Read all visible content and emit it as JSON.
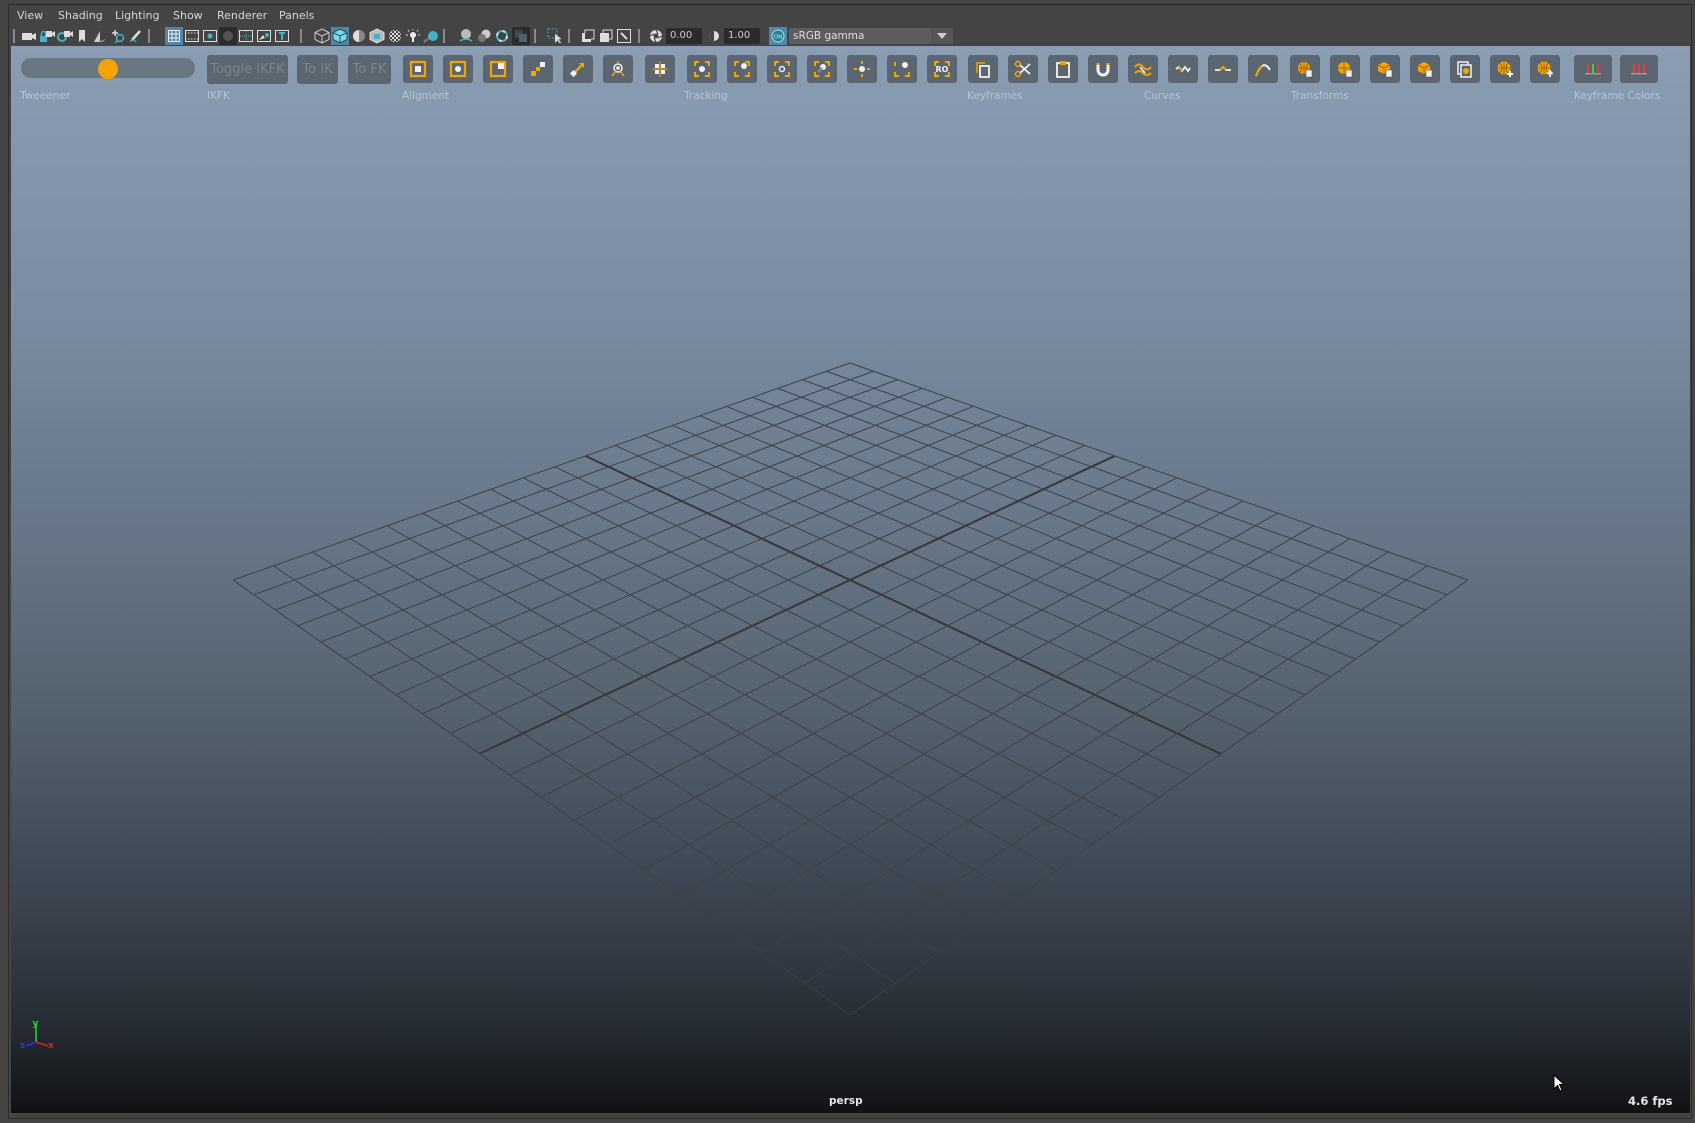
{
  "menu": {
    "items": [
      "View",
      "Shading",
      "Lighting",
      "Show",
      "Renderer",
      "Panels"
    ]
  },
  "toolbar": {
    "icons": [
      {
        "name": "select-camera-icon",
        "glyph": "camera"
      },
      {
        "name": "lock-camera-icon",
        "glyph": "camera-lock"
      },
      {
        "name": "camera-attributes-icon",
        "glyph": "camera-gear"
      },
      {
        "name": "bookmark-icon",
        "glyph": "bookmark"
      },
      {
        "name": "image-plane-icon",
        "glyph": "image-plane"
      },
      {
        "name": "2d-pan-zoom-icon",
        "glyph": "pan-zoom"
      },
      {
        "name": "grease-pencil-icon",
        "glyph": "pencil"
      },
      {
        "name": "grid-icon",
        "glyph": "grid",
        "active": true
      },
      {
        "name": "film-gate-icon",
        "glyph": "film"
      },
      {
        "name": "resolution-gate-icon",
        "glyph": "res-gate"
      },
      {
        "name": "gate-mask-icon",
        "glyph": "gate-mask",
        "pressed": true
      },
      {
        "name": "field-chart-icon",
        "glyph": "field-chart"
      },
      {
        "name": "safe-action-icon",
        "glyph": "safe-action"
      },
      {
        "name": "safe-title-icon",
        "glyph": "safe-title"
      },
      {
        "name": "wireframe-icon",
        "glyph": "wire-cube"
      },
      {
        "name": "smooth-shade-icon",
        "glyph": "solid-cube",
        "active": true
      },
      {
        "name": "default-material-icon",
        "glyph": "half-sphere"
      },
      {
        "name": "wireframe-on-shaded-icon",
        "glyph": "wire-shaded-cube"
      },
      {
        "name": "textured-icon",
        "glyph": "checker"
      },
      {
        "name": "use-all-lights-icon",
        "glyph": "bulb"
      },
      {
        "name": "shadows-icon",
        "glyph": "shadow-sphere"
      },
      {
        "name": "screen-space-ao-icon",
        "glyph": "ao-sphere"
      },
      {
        "name": "motion-blur-icon",
        "glyph": "blur-sphere"
      },
      {
        "name": "anti-aliasing-icon",
        "glyph": "aa-ring"
      },
      {
        "name": "depth-of-field-icon",
        "glyph": "dof",
        "pressed": true
      },
      {
        "name": "isolate-select-icon",
        "glyph": "isolate"
      },
      {
        "name": "xray-icon",
        "glyph": "xray"
      },
      {
        "name": "xray-active-icon",
        "glyph": "xray-active"
      },
      {
        "name": "xray-joints-icon",
        "glyph": "xray-joints"
      },
      {
        "name": "exposure-icon",
        "glyph": "aperture"
      },
      {
        "name": "gamma-icon",
        "glyph": "gamma"
      }
    ],
    "exposure_value": "0.00",
    "gamma_value": "1.00",
    "color_management_toggle": "ON",
    "color_space": "sRGB gamma"
  },
  "shelf": {
    "tweener": {
      "label": "Tweeener",
      "value_fraction": 0.5
    },
    "ikfk": {
      "label": "IKFK",
      "buttons": [
        "Toggle IKFK",
        "To IK",
        "To FK"
      ]
    },
    "groups": [
      {
        "label": "Aligment",
        "buttons": [
          "align-position-icon",
          "align-center-icon",
          "align-corner-icon",
          "align-snap-icon",
          "align-aim-icon",
          "align-pivot-icon"
        ]
      },
      {
        "label": "Tracking",
        "buttons": [
          "track-grid-icon",
          "track-center-icon",
          "track-rotate-icon",
          "track-offset-icon",
          "track-translate-icon",
          "track-point-icon",
          "track-corner-icon",
          "track-rotate-object-icon"
        ]
      },
      {
        "label": "Keyframes",
        "buttons": [
          "copy-keys-icon",
          "cut-keys-icon",
          "paste-keys-icon",
          "magnet-keys-icon"
        ]
      },
      {
        "label": "Curves",
        "buttons": [
          "curve-smooth-icon",
          "curve-noise-icon",
          "curve-flat-icon",
          "curve-arc-icon"
        ]
      },
      {
        "label": "Transforms",
        "buttons": [
          "copy-world-transform-icon",
          "paste-world-transform-icon",
          "copy-local-transform-icon",
          "paste-local-transform-icon",
          "duplicate-transform-icon",
          "add-world-transform-icon",
          "move-world-transform-icon"
        ]
      },
      {
        "label": "Keyframe Colors",
        "buttons": [
          "keyframe-colors-mixed-icon",
          "keyframe-colors-red-icon"
        ]
      }
    ]
  },
  "viewport": {
    "camera_name": "persp",
    "fps": "4.6 fps",
    "axis": {
      "x": "x",
      "y": "y",
      "z": "z"
    },
    "grid_divisions": 20
  }
}
